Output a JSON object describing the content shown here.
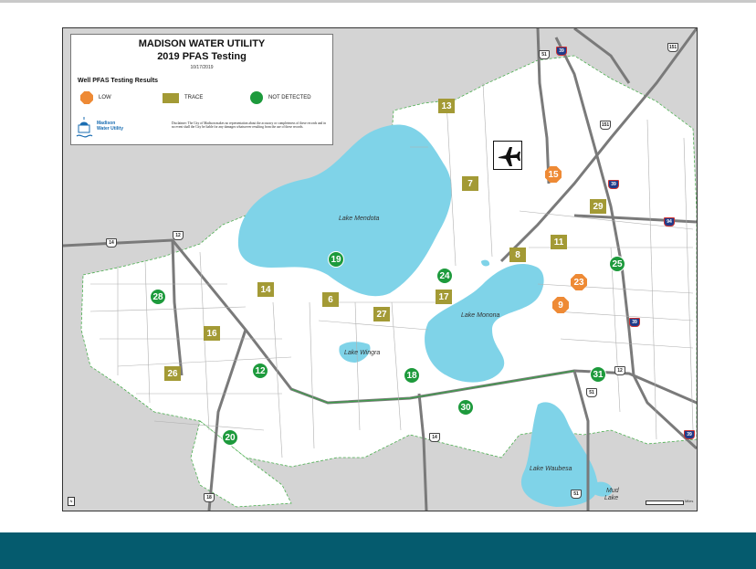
{
  "map": {
    "title_line1": "MADISON WATER UTILITY",
    "title_line2": "2019 PFAS Testing",
    "date": "10/17/2019",
    "legend_title": "Well PFAS Testing Results",
    "legend": {
      "low": "LOW",
      "trace": "TRACE",
      "not_detected": "NOT DETECTED"
    },
    "logo_text_1": "Madison",
    "logo_text_2": "Water Utility",
    "disclaimer": "Disclaimer: The City of Madison makes no representation about the accuracy or completeness of these records and in no event shall the City be liable for any damages whatsoever resulting from the use of these records.",
    "lakes": {
      "mendota": "Lake Mendota",
      "monona": "Lake Monona",
      "wingra": "Lake Wingra",
      "waubesa": "Lake Waubesa",
      "mud_1": "Mud",
      "mud_2": "Lake"
    },
    "scale_label": "Miles",
    "north_label": "N",
    "colors": {
      "low": "#ee8a35",
      "trace": "#a39a35",
      "not_detected": "#1d9a3c",
      "water": "#7fd3e8",
      "city": "#ffffff",
      "background": "#d4d4d4",
      "footer": "#055b6e"
    },
    "wells": [
      {
        "id": "13",
        "result": "trace"
      },
      {
        "id": "7",
        "result": "trace"
      },
      {
        "id": "15",
        "result": "low"
      },
      {
        "id": "29",
        "result": "trace"
      },
      {
        "id": "11",
        "result": "trace"
      },
      {
        "id": "8",
        "result": "trace"
      },
      {
        "id": "25",
        "result": "not_detected"
      },
      {
        "id": "23",
        "result": "low"
      },
      {
        "id": "9",
        "result": "low"
      },
      {
        "id": "24",
        "result": "not_detected"
      },
      {
        "id": "17",
        "result": "trace"
      },
      {
        "id": "19",
        "result": "not_detected"
      },
      {
        "id": "14",
        "result": "trace"
      },
      {
        "id": "6",
        "result": "trace"
      },
      {
        "id": "27",
        "result": "trace"
      },
      {
        "id": "28",
        "result": "not_detected"
      },
      {
        "id": "16",
        "result": "trace"
      },
      {
        "id": "26",
        "result": "trace"
      },
      {
        "id": "12",
        "result": "not_detected"
      },
      {
        "id": "18",
        "result": "not_detected"
      },
      {
        "id": "30",
        "result": "not_detected"
      },
      {
        "id": "31",
        "result": "not_detected"
      },
      {
        "id": "20",
        "result": "not_detected"
      }
    ],
    "highway_shields": [
      {
        "id": "shield-14-west",
        "label": "14",
        "type": "us"
      },
      {
        "id": "shield-12-west",
        "label": "12",
        "type": "us"
      },
      {
        "id": "shield-51-north",
        "label": "51",
        "type": "us"
      },
      {
        "id": "shield-39-north",
        "label": "39",
        "type": "int"
      },
      {
        "id": "shield-151-ne",
        "label": "151",
        "type": "us"
      },
      {
        "id": "shield-151-mid",
        "label": "151",
        "type": "us"
      },
      {
        "id": "shield-39-east",
        "label": "39",
        "type": "int"
      },
      {
        "id": "shield-94-east",
        "label": "94",
        "type": "int"
      },
      {
        "id": "shield-39-south",
        "label": "39",
        "type": "int"
      },
      {
        "id": "shield-12-east",
        "label": "12",
        "type": "us"
      },
      {
        "id": "shield-51-south",
        "label": "51",
        "type": "us"
      },
      {
        "id": "shield-14-south",
        "label": "14",
        "type": "us"
      },
      {
        "id": "shield-18-south",
        "label": "18",
        "type": "us"
      },
      {
        "id": "shield-51-bottom",
        "label": "51",
        "type": "us"
      },
      {
        "id": "shield-39-se",
        "label": "39",
        "type": "int"
      }
    ]
  }
}
